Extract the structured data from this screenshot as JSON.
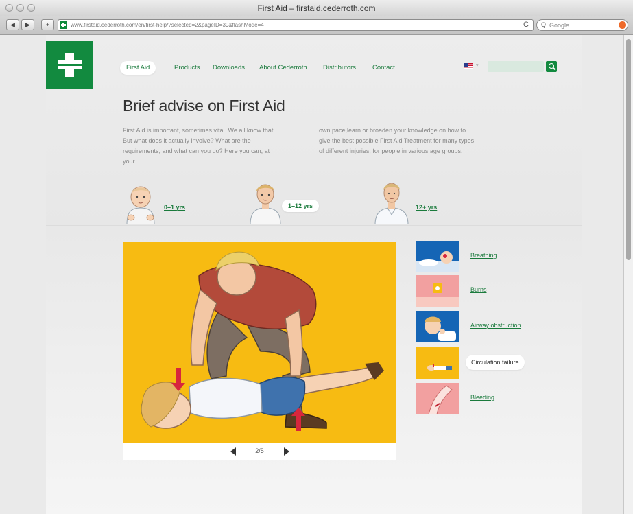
{
  "browser": {
    "window_title": "First Aid – firstaid.cederroth.com",
    "url": "www.firstaid.cederroth.com/en/first-help/?selected=2&pageID=39&flashMode=4",
    "search_placeholder": "Google",
    "back_glyph": "◀",
    "forward_glyph": "▶",
    "add_glyph": "+",
    "reload_glyph": "C",
    "search_glyph": "Q"
  },
  "site": {
    "brand_color": "#128a3f",
    "nav": [
      {
        "label": "First Aid",
        "active": true
      },
      {
        "label": "Products",
        "active": false
      },
      {
        "label": "Downloads",
        "active": false
      },
      {
        "label": "About Cederroth",
        "active": false
      },
      {
        "label": "Distributors",
        "active": false
      },
      {
        "label": "Contact",
        "active": false
      }
    ],
    "language_flag_icon": "us-flag-icon",
    "language_caret": "▾",
    "title": "Brief advise on First Aid",
    "intro_left": "First Aid is important, sometimes vital. We all know that. But what does it actually involve? What are the requirements, and what can you do? Here you can, at your",
    "intro_right": "own pace,learn or broaden your knowledge on how to give the best possible First Aid Treatment for many types of different injuries, for people in various age groups.",
    "age_groups": [
      {
        "label": "0–1 yrs",
        "active": false
      },
      {
        "label": "1–12 yrs",
        "active": true
      },
      {
        "label": "12+ yrs",
        "active": false
      }
    ],
    "slideshow": {
      "counter": "2/5",
      "background": "#f7bb12"
    },
    "topics": [
      {
        "label": "Breathing",
        "active": false,
        "thumb_bg": "#1565b5"
      },
      {
        "label": "Burns",
        "active": false,
        "thumb_bg": "#f2a0a0"
      },
      {
        "label": "Airway obstruction",
        "active": false,
        "thumb_bg": "#1565b5"
      },
      {
        "label": "Circulation failure",
        "active": true,
        "thumb_bg": "#f7bb12"
      },
      {
        "label": "Bleeding",
        "active": false,
        "thumb_bg": "#f2a0a0"
      }
    ]
  }
}
